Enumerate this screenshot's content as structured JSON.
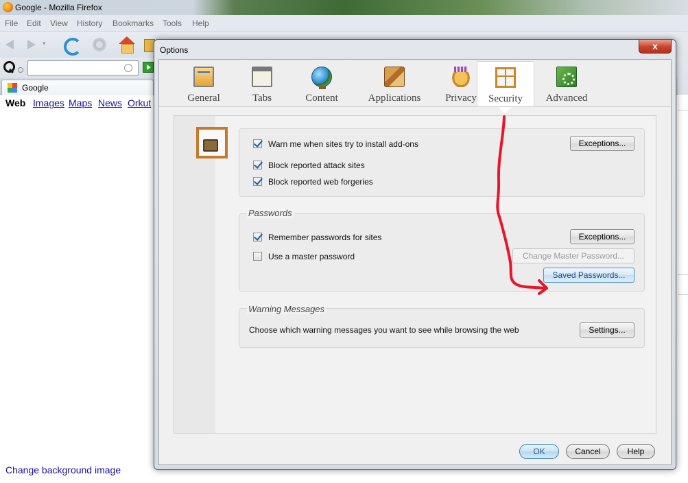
{
  "browser": {
    "window_title": "Google - Mozilla Firefox",
    "menu": [
      "File",
      "Edit",
      "View",
      "History",
      "Bookmarks",
      "Tools",
      "Help"
    ],
    "search_placeholder": "",
    "tab_title": "Google",
    "google_nav": [
      "Web",
      "Images",
      "Maps",
      "News",
      "Orkut"
    ],
    "change_background": "Change background image"
  },
  "dialog": {
    "title": "Options",
    "close_glyph": "x",
    "tabs": [
      {
        "label": "General",
        "icon": "general-icon"
      },
      {
        "label": "Tabs",
        "icon": "tabs-icon"
      },
      {
        "label": "Content",
        "icon": "content-icon"
      },
      {
        "label": "Applications",
        "icon": "applications-icon"
      },
      {
        "label": "Privacy",
        "icon": "privacy-icon"
      },
      {
        "label": "Security",
        "icon": "security-icon",
        "active": true
      },
      {
        "label": "Advanced",
        "icon": "advanced-icon"
      }
    ],
    "general_group": {
      "warn_addons": {
        "label": "Warn me when sites try to install add-ons",
        "checked": true
      },
      "block_attack": {
        "label": "Block reported attack sites",
        "checked": true
      },
      "block_forgeries": {
        "label": "Block reported web forgeries",
        "checked": true
      },
      "exceptions_label": "Exceptions..."
    },
    "passwords_group": {
      "caption": "Passwords",
      "remember": {
        "label": "Remember passwords for sites",
        "checked": true
      },
      "master": {
        "label": "Use a master password",
        "checked": false
      },
      "exceptions_label": "Exceptions...",
      "change_master_label": "Change Master Password...",
      "saved_passwords_label": "Saved Passwords..."
    },
    "warnings_group": {
      "caption": "Warning Messages",
      "description": "Choose which warning messages you want to see while browsing the web",
      "settings_label": "Settings..."
    },
    "buttons": {
      "ok": "OK",
      "cancel": "Cancel",
      "help": "Help"
    },
    "annotation_color": "#e8152b"
  }
}
